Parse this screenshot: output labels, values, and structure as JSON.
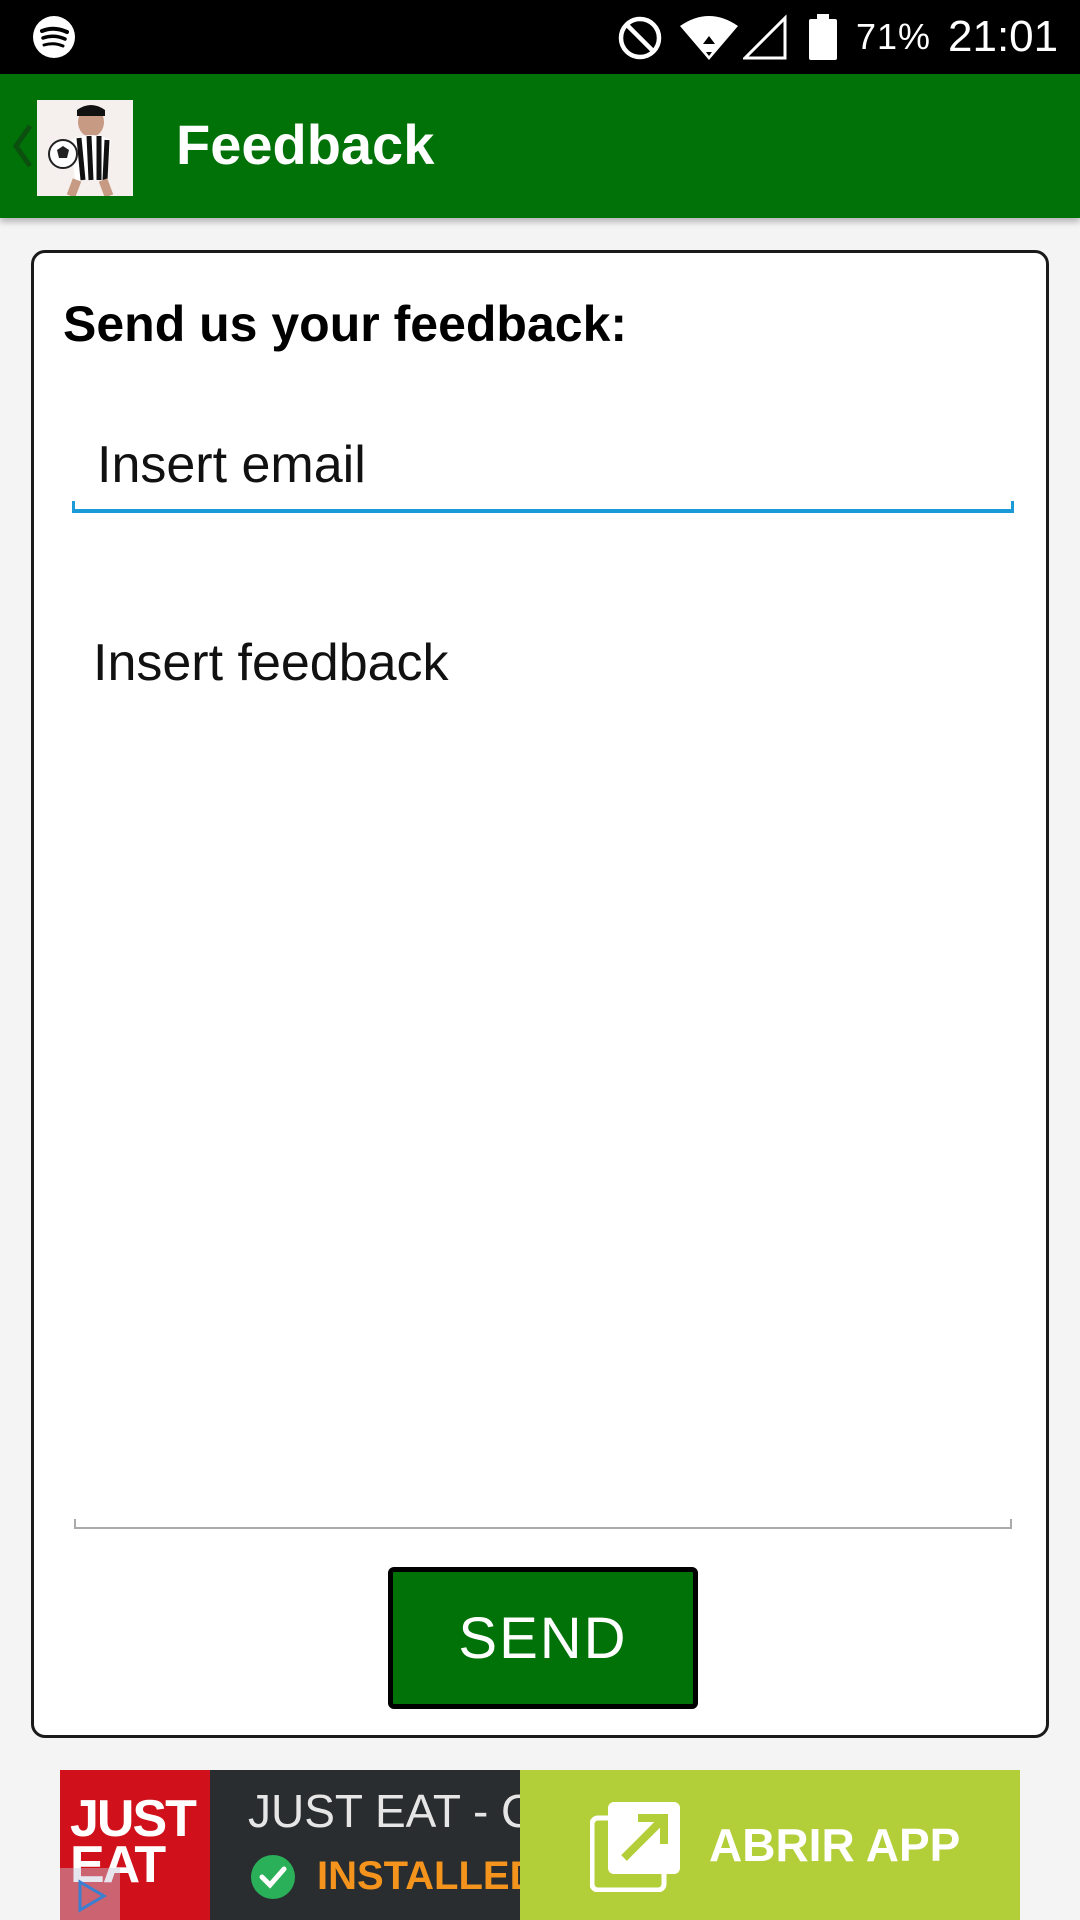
{
  "status_bar": {
    "battery_percent": "71%",
    "time": "21:01",
    "icons": [
      "spotify-icon",
      "do-not-disturb-icon",
      "wifi-icon",
      "cell-signal-icon",
      "battery-icon"
    ]
  },
  "app_bar": {
    "title": "Feedback",
    "icons": [
      "back-chevron-icon",
      "app-logo"
    ]
  },
  "form": {
    "heading": "Send us your feedback:",
    "email_placeholder": "Insert email",
    "feedback_placeholder": "Insert feedback",
    "send_label": "SEND"
  },
  "ad": {
    "brand_logo": "JUST EAT",
    "title": "JUST EAT - C",
    "status": "INSTALLED",
    "cta_label": "ABRIR APP",
    "icons": [
      "ad-choices-icon",
      "check-circle-icon",
      "open-external-icon"
    ]
  },
  "colors": {
    "app_bar": "#007208",
    "send_button": "#007208",
    "email_underline": "#1a9ad6",
    "ad_logo_bg": "#d0111b",
    "ad_cta_bg": "#b2cf3a",
    "ad_status": "#f4941d"
  }
}
